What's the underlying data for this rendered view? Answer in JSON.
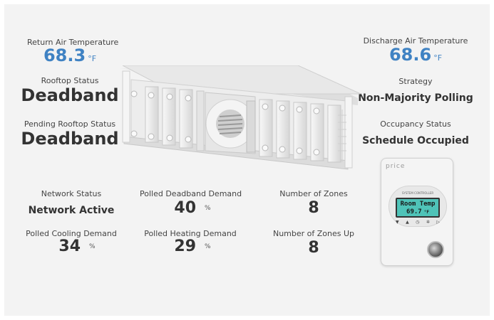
{
  "return_air": {
    "label": "Return Air Temperature",
    "value": "68.3",
    "unit": "°F"
  },
  "discharge_air": {
    "label": "Discharge Air Temperature",
    "value": "68.6",
    "unit": "°F"
  },
  "rooftop_status": {
    "label": "Rooftop Status",
    "value": "Deadband"
  },
  "pending_rooftop_status": {
    "label": "Pending Rooftop Status",
    "value": "Deadband"
  },
  "strategy": {
    "label": "Strategy",
    "value": "Non-Majority Polling"
  },
  "occupancy_status": {
    "label": "Occupancy Status",
    "value": "Schedule Occupied"
  },
  "network_status": {
    "label": "Network Status",
    "value": "Network Active"
  },
  "polled_deadband_demand": {
    "label": "Polled Deadband Demand",
    "value": "40",
    "unit": "%"
  },
  "number_of_zones": {
    "label": "Number of Zones",
    "value": "8"
  },
  "polled_cooling_demand": {
    "label": "Polled Cooling Demand",
    "value": "34",
    "unit": "%"
  },
  "polled_heating_demand": {
    "label": "Polled Heating Demand",
    "value": "29",
    "unit": "%"
  },
  "number_of_zones_up": {
    "label": "Number of Zones Up",
    "value": "8"
  },
  "thermostat": {
    "brand": "price",
    "header": "SYSTEM CONTROLLER",
    "screen_line1": "Room Temp",
    "screen_line2": "69.7",
    "screen_unit": "°F",
    "screen_color": "#4fc3b8"
  },
  "colors": {
    "accent": "#3f82c3",
    "panel_bg": "#f3f3f3"
  }
}
